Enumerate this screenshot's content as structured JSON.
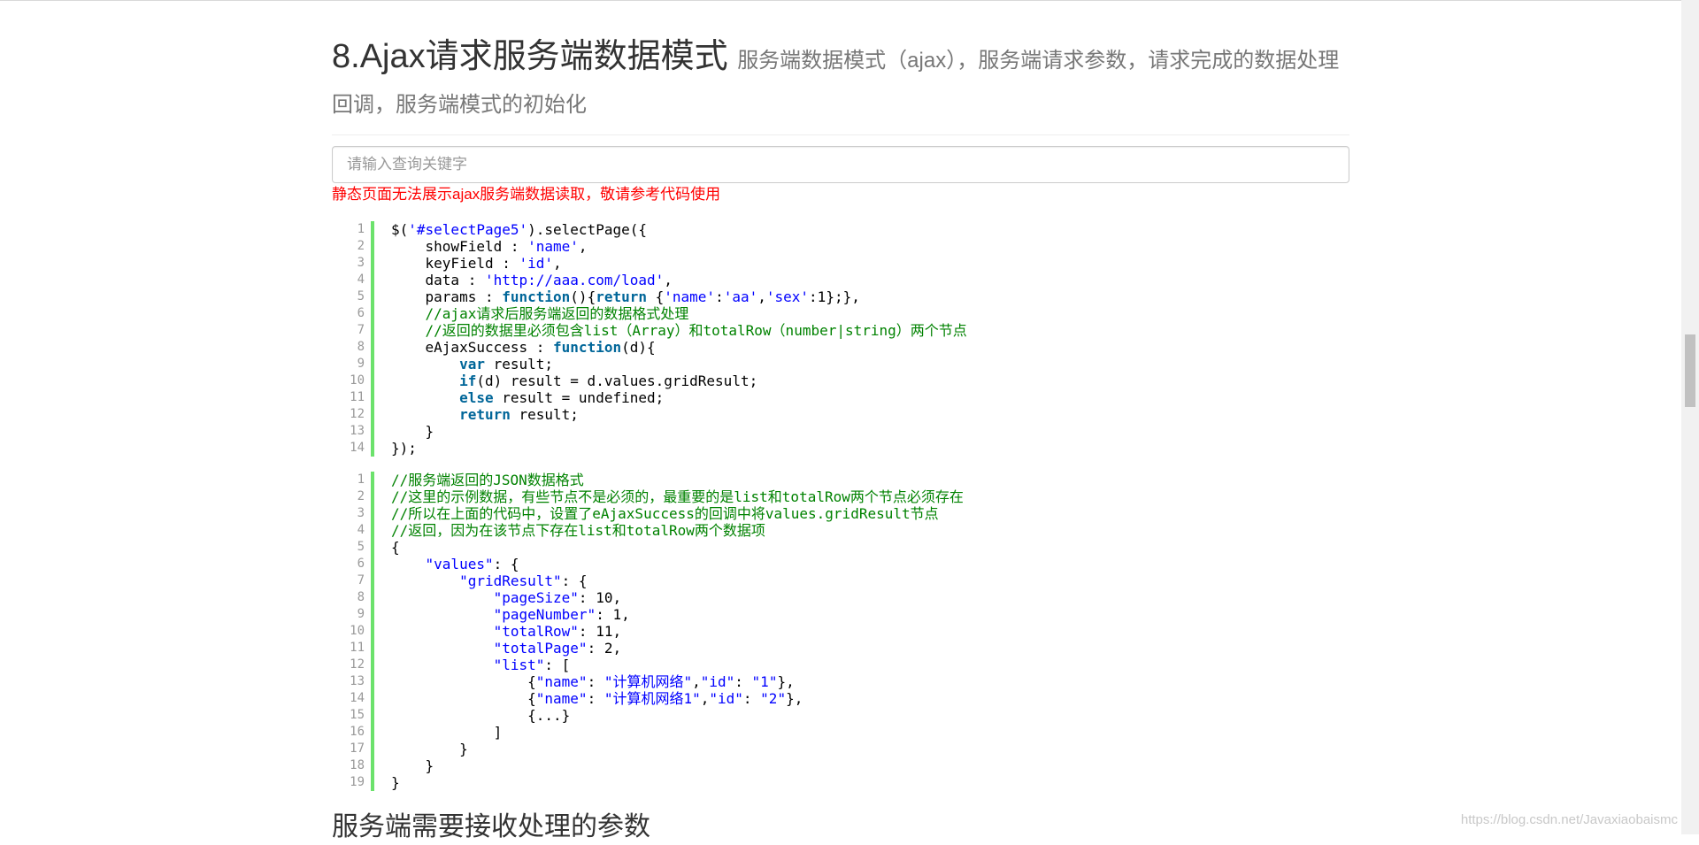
{
  "header": {
    "title": "8.Ajax请求服务端数据模式",
    "subtitle": "服务端数据模式（ajax），服务端请求参数，请求完成的数据处理回调，服务端模式的初始化"
  },
  "search": {
    "placeholder": "请输入查询关键字",
    "value": ""
  },
  "notice": "静态页面无法展示ajax服务端数据读取，敬请参考代码使用",
  "code_block_1": {
    "lines": [
      [
        [
          "t",
          "$("
        ],
        [
          "s",
          "'#selectPage5'"
        ],
        [
          "t",
          ").selectPage({"
        ]
      ],
      [
        [
          "t",
          "    showField : "
        ],
        [
          "s",
          "'name'"
        ],
        [
          "t",
          ","
        ]
      ],
      [
        [
          "t",
          "    keyField : "
        ],
        [
          "s",
          "'id'"
        ],
        [
          "t",
          ","
        ]
      ],
      [
        [
          "t",
          "    data : "
        ],
        [
          "s",
          "'http://aaa.com/load'"
        ],
        [
          "t",
          ","
        ]
      ],
      [
        [
          "t",
          "    params : "
        ],
        [
          "k",
          "function"
        ],
        [
          "t",
          "(){"
        ],
        [
          "k",
          "return"
        ],
        [
          "t",
          " {"
        ],
        [
          "s",
          "'name'"
        ],
        [
          "t",
          ":"
        ],
        [
          "s",
          "'aa'"
        ],
        [
          "t",
          ","
        ],
        [
          "s",
          "'sex'"
        ],
        [
          "t",
          ":1};},"
        ]
      ],
      [
        [
          "c",
          "    //ajax请求后服务端返回的数据格式处理"
        ]
      ],
      [
        [
          "c",
          "    //返回的数据里必须包含list（Array）和totalRow（number|string）两个节点"
        ]
      ],
      [
        [
          "t",
          "    eAjaxSuccess : "
        ],
        [
          "k",
          "function"
        ],
        [
          "t",
          "(d){"
        ]
      ],
      [
        [
          "t",
          "        "
        ],
        [
          "k",
          "var"
        ],
        [
          "t",
          " result;"
        ]
      ],
      [
        [
          "t",
          "        "
        ],
        [
          "k",
          "if"
        ],
        [
          "t",
          "(d) result = d.values.gridResult;"
        ]
      ],
      [
        [
          "t",
          "        "
        ],
        [
          "k",
          "else"
        ],
        [
          "t",
          " result = undefined;"
        ]
      ],
      [
        [
          "t",
          "        "
        ],
        [
          "k",
          "return"
        ],
        [
          "t",
          " result;"
        ]
      ],
      [
        [
          "t",
          "    }"
        ]
      ],
      [
        [
          "t",
          "});"
        ]
      ]
    ]
  },
  "code_block_2": {
    "lines": [
      [
        [
          "c",
          "//服务端返回的JSON数据格式"
        ]
      ],
      [
        [
          "c",
          "//这里的示例数据，有些节点不是必须的，最重要的是list和totalRow两个节点必须存在"
        ]
      ],
      [
        [
          "c",
          "//所以在上面的代码中，设置了eAjaxSuccess的回调中将values.gridResult节点"
        ]
      ],
      [
        [
          "c",
          "//返回，因为在该节点下存在list和totalRow两个数据项"
        ]
      ],
      [
        [
          "t",
          "{"
        ]
      ],
      [
        [
          "t",
          "    "
        ],
        [
          "s",
          "\"values\""
        ],
        [
          "t",
          ": {"
        ]
      ],
      [
        [
          "t",
          "        "
        ],
        [
          "s",
          "\"gridResult\""
        ],
        [
          "t",
          ": {"
        ]
      ],
      [
        [
          "t",
          "            "
        ],
        [
          "s",
          "\"pageSize\""
        ],
        [
          "t",
          ": 10,"
        ]
      ],
      [
        [
          "t",
          "            "
        ],
        [
          "s",
          "\"pageNumber\""
        ],
        [
          "t",
          ": 1,"
        ]
      ],
      [
        [
          "t",
          "            "
        ],
        [
          "s",
          "\"totalRow\""
        ],
        [
          "t",
          ": 11,"
        ]
      ],
      [
        [
          "t",
          "            "
        ],
        [
          "s",
          "\"totalPage\""
        ],
        [
          "t",
          ": 2,"
        ]
      ],
      [
        [
          "t",
          "            "
        ],
        [
          "s",
          "\"list\""
        ],
        [
          "t",
          ": ["
        ]
      ],
      [
        [
          "t",
          "                {"
        ],
        [
          "s",
          "\"name\""
        ],
        [
          "t",
          ": "
        ],
        [
          "s",
          "\"计算机网络\""
        ],
        [
          "t",
          ","
        ],
        [
          "s",
          "\"id\""
        ],
        [
          "t",
          ": "
        ],
        [
          "s",
          "\"1\""
        ],
        [
          "t",
          "},"
        ]
      ],
      [
        [
          "t",
          "                {"
        ],
        [
          "s",
          "\"name\""
        ],
        [
          "t",
          ": "
        ],
        [
          "s",
          "\"计算机网络1\""
        ],
        [
          "t",
          ","
        ],
        [
          "s",
          "\"id\""
        ],
        [
          "t",
          ": "
        ],
        [
          "s",
          "\"2\""
        ],
        [
          "t",
          "},"
        ]
      ],
      [
        [
          "t",
          "                {...}"
        ]
      ],
      [
        [
          "t",
          "            ]"
        ]
      ],
      [
        [
          "t",
          "        }"
        ]
      ],
      [
        [
          "t",
          "    }"
        ]
      ],
      [
        [
          "t",
          "}"
        ]
      ]
    ]
  },
  "section_heading": "服务端需要接收处理的参数",
  "watermark": "https://blog.csdn.net/Javaxiaobaismc",
  "colors": {
    "keyword": "#006699",
    "string": "#0000ff",
    "comment": "#008200",
    "gutter_bar": "#6ce26c",
    "notice": "#ff0000"
  }
}
